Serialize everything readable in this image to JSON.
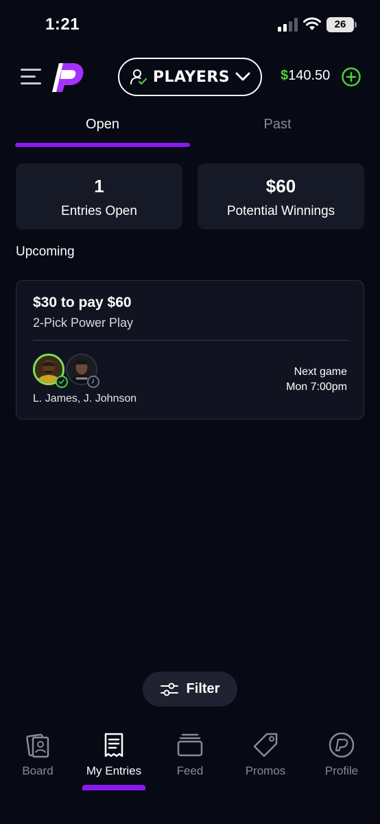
{
  "status_bar": {
    "time": "1:21",
    "battery": "26"
  },
  "header": {
    "mode_label": "PLAYERS",
    "balance_symbol": "$",
    "balance_amount": "140.50"
  },
  "tabs": [
    {
      "label": "Open",
      "active": true
    },
    {
      "label": "Past",
      "active": false
    }
  ],
  "stats": [
    {
      "value": "1",
      "label": "Entries Open"
    },
    {
      "value": "$60",
      "label": "Potential Winnings"
    }
  ],
  "section_title": "Upcoming",
  "entry": {
    "title": "$30 to pay $60",
    "subtitle": "2-Pick Power Play",
    "players": "L. James, J. Johnson",
    "next_game_label": "Next game",
    "next_game_time": "Mon 7:00pm"
  },
  "filter": {
    "label": "Filter"
  },
  "nav": [
    {
      "label": "Board",
      "icon": "board-icon"
    },
    {
      "label": "My Entries",
      "icon": "receipt-icon",
      "active": true
    },
    {
      "label": "Feed",
      "icon": "feed-icon"
    },
    {
      "label": "Promos",
      "icon": "tag-icon"
    },
    {
      "label": "Profile",
      "icon": "profile-icon"
    }
  ],
  "colors": {
    "background": "#070914",
    "card": "#161926",
    "accent_purple": "#8b19f2",
    "accent_green": "#4cd137"
  }
}
